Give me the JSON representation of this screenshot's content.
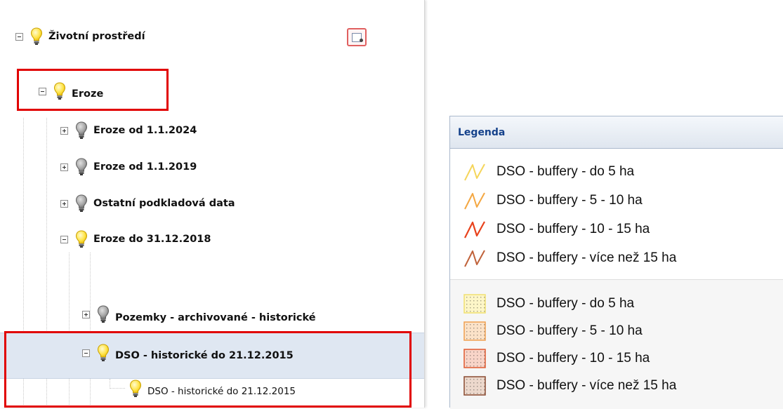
{
  "tree": {
    "root": {
      "label": "Životní prostředí"
    },
    "eroze": {
      "label": "Eroze"
    },
    "children": [
      {
        "label": "Eroze od 1.1.2024"
      },
      {
        "label": "Eroze od 1.1.2019"
      },
      {
        "label": "Ostatní podkladová data"
      },
      {
        "label": "Eroze do 31.12.2018"
      }
    ],
    "pozemky": {
      "label": "Pozemky - archivované - historické"
    },
    "dso_group": {
      "label": "DSO - historické do 21.12.2015"
    },
    "dso_layer": {
      "label": "DSO - historické do 21.12.2015"
    }
  },
  "legend": {
    "title": "Legenda",
    "line_items": [
      {
        "label": "DSO - buffery - do 5 ha",
        "color": "#f5d55a"
      },
      {
        "label": "DSO - buffery - 5 - 10 ha",
        "color": "#f4a742"
      },
      {
        "label": "DSO - buffery - 10 - 15 ha",
        "color": "#e8421c"
      },
      {
        "label": "DSO - buffery - více než 15 ha",
        "color": "#c0623a"
      }
    ],
    "fill_items": [
      {
        "label": "DSO - buffery - do 5 ha",
        "color": "#f0e070"
      },
      {
        "label": "DSO - buffery - 5 - 10 ha",
        "color": "#f0a050"
      },
      {
        "label": "DSO - buffery - 10 - 15 ha",
        "color": "#e05a30"
      },
      {
        "label": "DSO - buffery - více než 15 ha",
        "color": "#8a4a30"
      }
    ]
  },
  "colors": {
    "bulb_on": "#ffe44a",
    "bulb_off": "#9a9a9a",
    "highlight_box": "#e10000",
    "selected_row": "#dfe7f2"
  }
}
